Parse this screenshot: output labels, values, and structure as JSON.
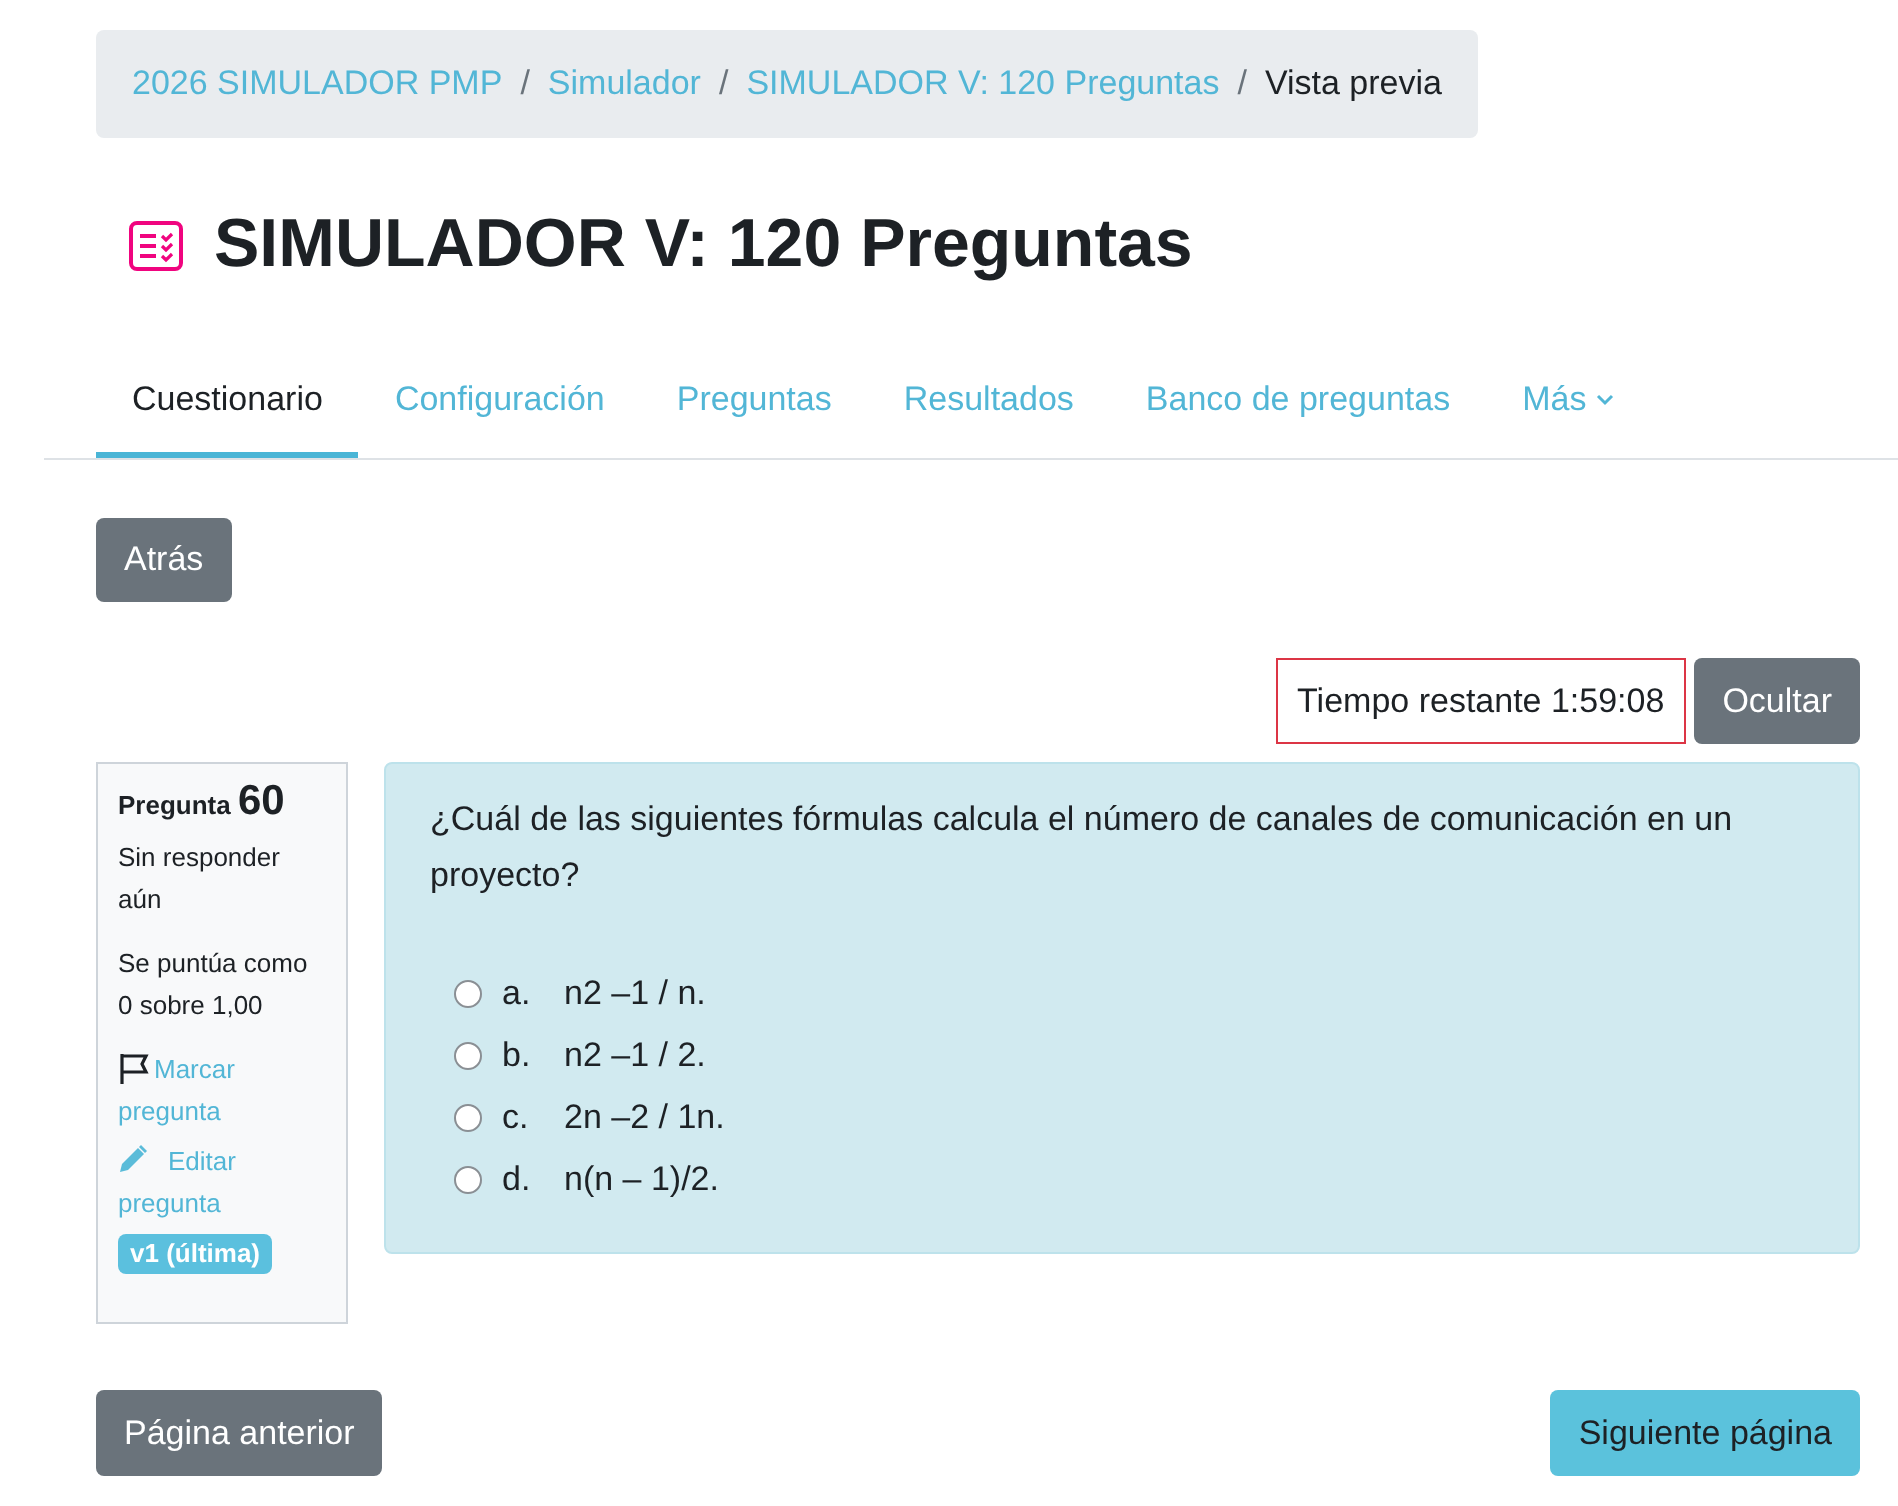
{
  "breadcrumb": {
    "separator": "/",
    "items": [
      {
        "label": "2026 SIMULADOR PMP",
        "kind": "link"
      },
      {
        "label": "Simulador",
        "kind": "link"
      },
      {
        "label": "SIMULADOR V: 120 Preguntas",
        "kind": "link"
      },
      {
        "label": "Vista previa",
        "kind": "current"
      }
    ]
  },
  "page_title": "SIMULADOR V: 120 Preguntas",
  "tabs": [
    {
      "label": "Cuestionario",
      "selected": true,
      "kind": "tab"
    },
    {
      "label": "Configuración",
      "selected": false,
      "kind": "tab"
    },
    {
      "label": "Preguntas",
      "selected": false,
      "kind": "tab"
    },
    {
      "label": "Resultados",
      "selected": false,
      "kind": "tab"
    },
    {
      "label": "Banco de preguntas",
      "selected": false,
      "kind": "tab"
    },
    {
      "label": "Más",
      "selected": false,
      "kind": "dropdown"
    }
  ],
  "back_button": "Atrás",
  "timer": {
    "text": "Tiempo restante 1:59:08",
    "hide_button": "Ocultar"
  },
  "question_info": {
    "label": "Pregunta",
    "number": "60",
    "status": "Sin responder aún",
    "grade": "Se puntúa como 0 sobre 1,00",
    "flag_link": "Marcar pregunta",
    "flagged": false,
    "edit_link": "Editar pregunta",
    "version_badge": "v1 (última)"
  },
  "question": {
    "text": "¿Cuál de las siguientes fórmulas calcula el número de canales de comunicación en un proyecto?",
    "options": [
      {
        "letter": "a.",
        "text": "n2 –1 / n.",
        "selected": false
      },
      {
        "letter": "b.",
        "text": "n2 –1 / 2.",
        "selected": false
      },
      {
        "letter": "c.",
        "text": "2n –2 / 1n.",
        "selected": false
      },
      {
        "letter": "d.",
        "text": "n(n – 1)/2.",
        "selected": false
      }
    ]
  },
  "navigation": {
    "previous_button": "Página anterior",
    "next_button": "Siguiente página"
  }
}
